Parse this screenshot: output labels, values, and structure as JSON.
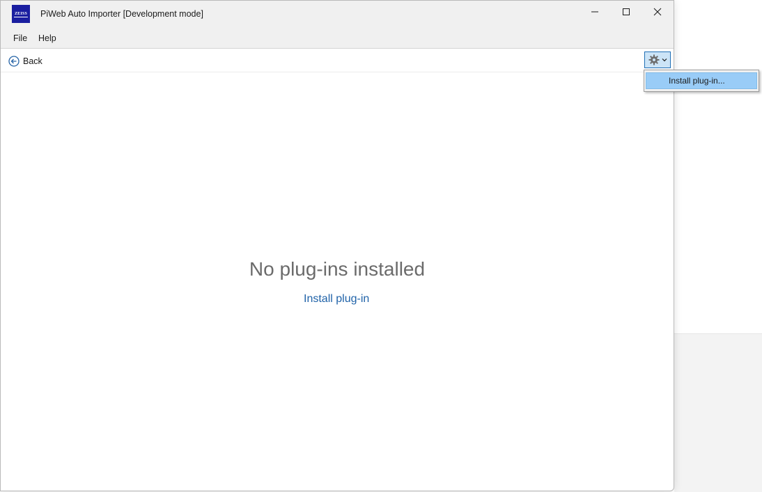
{
  "window": {
    "title": "PiWeb Auto Importer [Development mode]",
    "logo_text": "ZEISS"
  },
  "menu": {
    "file": "File",
    "help": "Help"
  },
  "toolbar": {
    "back_label": "Back",
    "settings_icon": "gear-icon"
  },
  "dropdown": {
    "install_item": "Install plug-in..."
  },
  "main": {
    "empty_title": "No plug-ins installed",
    "install_link": "Install plug-in"
  },
  "colors": {
    "accent": "#1f62a8",
    "selection": "#99ccf7",
    "logo": "#1a1ea0"
  }
}
